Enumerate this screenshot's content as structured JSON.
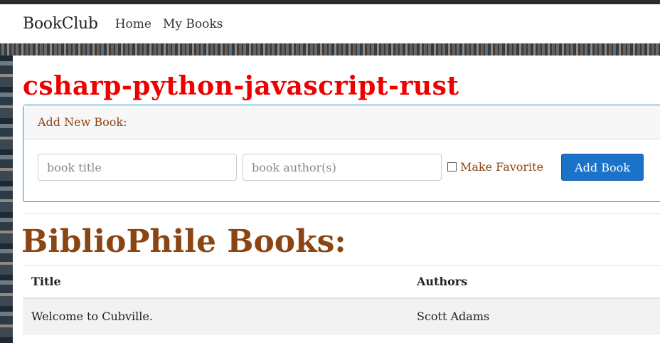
{
  "navbar": {
    "brand": "BookClub",
    "links": [
      "Home",
      "My Books"
    ]
  },
  "page_title": "csharp-python-javascript-rust",
  "add_book": {
    "header": "Add New Book:",
    "title_placeholder": "book title",
    "author_placeholder": "book author(s)",
    "favorite_label": "Make Favorite",
    "favorite_checked": false,
    "submit_label": "Add Book"
  },
  "books": {
    "heading": "BiblioPhile Books:",
    "columns": [
      "Title",
      "Authors"
    ],
    "rows": [
      {
        "title": "Welcome to Cubville.",
        "authors": "Scott Adams"
      }
    ]
  },
  "colors": {
    "page_title": "#ee0000",
    "accent_brown": "#8b4513",
    "button_blue": "#1a73c9",
    "card_border": "#1f8dd6"
  }
}
